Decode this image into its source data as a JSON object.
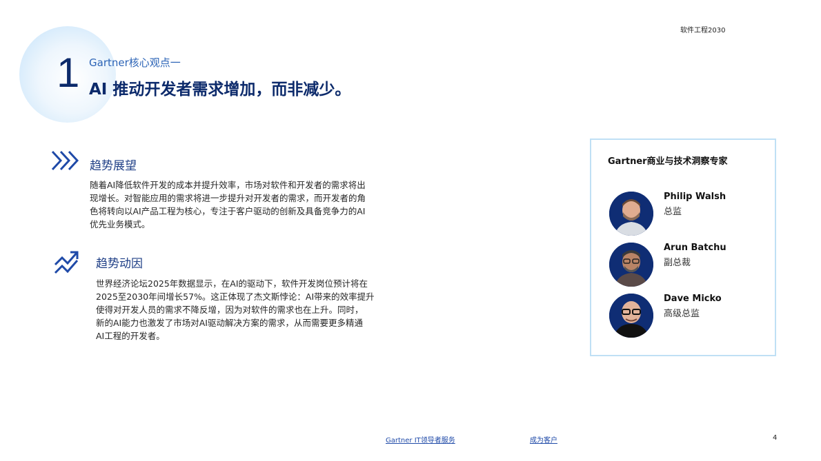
{
  "header": {
    "doc_label": "软件工程2030"
  },
  "hero": {
    "number": "1",
    "subtitle": "Gartner核心观点一",
    "title": "AI 推动开发者需求增加，而非减少。"
  },
  "sections": [
    {
      "title": "趋势展望",
      "icon": "triple-chevron-right-icon",
      "lines": [
        "随着AI降低软件开发的成本并提升效率，市场对软件和开发者的需求将出",
        "现增长。对智能应用的需求将进一步提升对开发者的需求，而开发者的角",
        "色将转向以AI产品工程为核心，专注于客户驱动的创新及具备竞争力的AI",
        "优先业务模式。"
      ]
    },
    {
      "title": "趋势动因",
      "icon": "trending-up-icon",
      "lines": [
        "世界经济论坛2025年数据显示，在AI的驱动下，软件开发岗位预计将在",
        "2025至2030年间增长57%。这正体现了杰文斯悖论：AI带来的效率提升",
        "使得对开发人员的需求不降反增，因为对软件的需求也在上升。同时，",
        "新的AI能力也激发了市场对AI驱动解决方案的需求，从而需要更多精通",
        "AI工程的开发者。"
      ]
    }
  ],
  "experts": {
    "title": "Gartner商业与技术洞察专家",
    "people": [
      {
        "name": "Philip  Walsh",
        "role": "总监"
      },
      {
        "name": "Arun  Batchu",
        "role": "副总裁"
      },
      {
        "name": "Dave  Micko",
        "role": "高级总监"
      }
    ]
  },
  "footer": {
    "link1": "Gartner  IT领导者服务",
    "link2": "成为客户",
    "page": "4"
  },
  "colors": {
    "navy": "#0c2a6b",
    "accent_blue": "#2b63b6",
    "card_border": "#bfe0f5"
  }
}
